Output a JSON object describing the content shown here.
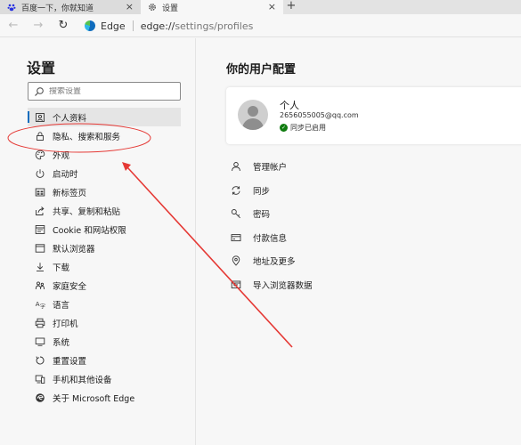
{
  "tabs": [
    {
      "title": "百度一下，你就知道",
      "icon": "baidu-paw-icon",
      "close": "×"
    },
    {
      "title": "设置",
      "icon": "gear-icon",
      "close": "×"
    }
  ],
  "new_tab": "+",
  "toolbar": {
    "back": "←",
    "forward": "→",
    "reload": "↻",
    "site_label": "Edge",
    "url_scheme": "edge://",
    "url_path": "settings/profiles"
  },
  "sidebar": {
    "title": "设置",
    "search_placeholder": "搜索设置",
    "items": [
      {
        "label": "个人资料",
        "icon": "profile-icon",
        "active": true
      },
      {
        "label": "隐私、搜索和服务",
        "icon": "lock-icon"
      },
      {
        "label": "外观",
        "icon": "palette-icon"
      },
      {
        "label": "启动时",
        "icon": "power-icon"
      },
      {
        "label": "新标签页",
        "icon": "new-tab-icon"
      },
      {
        "label": "共享、复制和粘贴",
        "icon": "share-icon"
      },
      {
        "label": "Cookie 和网站权限",
        "icon": "site-permissions-icon"
      },
      {
        "label": "默认浏览器",
        "icon": "browser-icon"
      },
      {
        "label": "下载",
        "icon": "download-icon"
      },
      {
        "label": "家庭安全",
        "icon": "family-icon"
      },
      {
        "label": "语言",
        "icon": "language-icon"
      },
      {
        "label": "打印机",
        "icon": "printer-icon"
      },
      {
        "label": "系统",
        "icon": "system-icon"
      },
      {
        "label": "重置设置",
        "icon": "reset-icon"
      },
      {
        "label": "手机和其他设备",
        "icon": "phone-icon"
      },
      {
        "label": "关于 Microsoft Edge",
        "icon": "edge-logo-icon"
      }
    ]
  },
  "main": {
    "title": "你的用户配置",
    "profile": {
      "name": "个人",
      "email": "2656055005@qq.com",
      "sync_status": "同步已启用",
      "sync_color": "#107c10"
    },
    "items": [
      {
        "label": "管理帐户",
        "icon": "person-icon"
      },
      {
        "label": "同步",
        "icon": "sync-icon"
      },
      {
        "label": "密码",
        "icon": "key-icon"
      },
      {
        "label": "付款信息",
        "icon": "card-icon"
      },
      {
        "label": "地址及更多",
        "icon": "location-icon"
      },
      {
        "label": "导入浏览器数据",
        "icon": "import-icon"
      }
    ]
  },
  "colors": {
    "accent": "#0f6cbd",
    "annotation": "#e53935"
  }
}
